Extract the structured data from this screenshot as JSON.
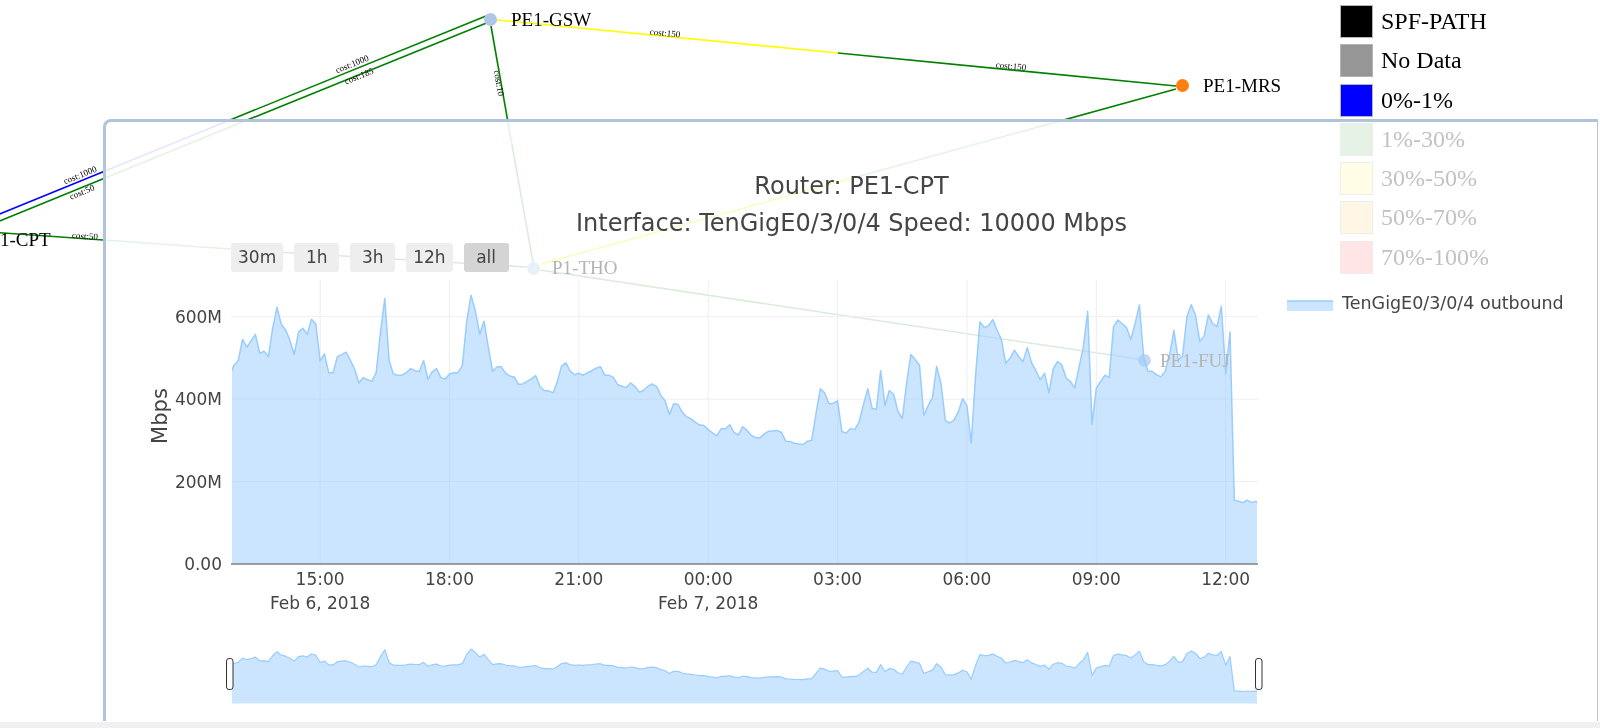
{
  "network_map": {
    "links": [
      {
        "color": "#008000",
        "cost": "cost:1000",
        "dimmed": false
      },
      {
        "color": "#0000ff",
        "cost": "cost:1000",
        "dimmed": false
      },
      {
        "color": "#008000",
        "cost": "cost:185",
        "dimmed": false
      },
      {
        "color": "#008000",
        "cost": "cost:50",
        "dimmed": false
      },
      {
        "color": "#008000",
        "cost": "cost:10",
        "dimmed": false
      },
      {
        "color": "#dcecdc",
        "dimmed": true
      },
      {
        "color": "#ffff00",
        "cost": "cost:150",
        "dimmed": false
      },
      {
        "color": "#008000",
        "cost": "cost:150",
        "dimmed": false
      },
      {
        "color": "#008000",
        "dimmed": false
      },
      {
        "color": "#fbfbc4",
        "dimmed": true
      },
      {
        "color": "#008000",
        "cost": "cost:50",
        "dimmed": false
      },
      {
        "color": "#dcecdc",
        "dimmed": true
      },
      {
        "color": "#dcecdc",
        "dimmed": true
      },
      {
        "color": "#dcecdc",
        "dimmed": true
      }
    ],
    "nodes": [
      {
        "label": "PE1-GSW",
        "color": "#aec7e8",
        "dimmed": false
      },
      {
        "label": "PE1-MRS",
        "color": "#ff7f0e",
        "dimmed": false
      },
      {
        "label": "1-CPT",
        "dimmed": false
      },
      {
        "label": "P1-THO",
        "color": "#eaf0f8",
        "dimmed": true
      },
      {
        "label": "PE1-FUJ",
        "color": "#c4d9ef",
        "dimmed": true
      }
    ],
    "legend": [
      {
        "label": "SPF-PATH",
        "color": "#000000",
        "dimmed": false
      },
      {
        "label": "No Data",
        "color": "#969696",
        "dimmed": false
      },
      {
        "label": "0%-1%",
        "color": "#0000ff",
        "dimmed": false
      },
      {
        "label": "1%-30%",
        "color": "#e5f2e5",
        "dimmed": true
      },
      {
        "label": "30%-50%",
        "color": "#fffde5",
        "dimmed": true
      },
      {
        "label": "50%-70%",
        "color": "#fff6e5",
        "dimmed": true
      },
      {
        "label": "70%-100%",
        "color": "#ffe5e5",
        "dimmed": true
      }
    ]
  },
  "chart_panel": {
    "subtitle": "Interface: TenGigE0/3/0/4 Speed: 10000 Mbps",
    "range_buttons": [
      {
        "label": "30m",
        "selected": false
      },
      {
        "label": "1h",
        "selected": false
      },
      {
        "label": "3h",
        "selected": false
      },
      {
        "label": "12h",
        "selected": false
      },
      {
        "label": "all",
        "selected": true
      }
    ],
    "chart_data": {
      "type": "area",
      "title": "Router: PE1-CPT",
      "ylabel": "Mbps",
      "grid": true,
      "x": [
        "2018-02-06 12:56",
        "2018-02-06 13:00",
        "2018-02-06 13:06",
        "2018-02-06 13:12",
        "2018-02-06 13:18",
        "2018-02-06 13:24",
        "2018-02-06 13:30",
        "2018-02-06 13:36",
        "2018-02-06 13:42",
        "2018-02-06 13:48",
        "2018-02-06 13:54",
        "2018-02-06 14:00",
        "2018-02-06 14:06",
        "2018-02-06 14:12",
        "2018-02-06 14:18",
        "2018-02-06 14:24",
        "2018-02-06 14:30",
        "2018-02-06 14:36",
        "2018-02-06 14:42",
        "2018-02-06 14:48",
        "2018-02-06 14:54",
        "2018-02-06 15:00",
        "2018-02-06 15:06",
        "2018-02-06 15:12",
        "2018-02-06 15:18",
        "2018-02-06 15:24",
        "2018-02-06 15:30",
        "2018-02-06 15:36",
        "2018-02-06 15:42",
        "2018-02-06 15:48",
        "2018-02-06 15:54",
        "2018-02-06 16:00",
        "2018-02-06 16:06",
        "2018-02-06 16:12",
        "2018-02-06 16:18",
        "2018-02-06 16:24",
        "2018-02-06 16:30",
        "2018-02-06 16:36",
        "2018-02-06 16:42",
        "2018-02-06 16:48",
        "2018-02-06 16:54",
        "2018-02-06 17:00",
        "2018-02-06 17:06",
        "2018-02-06 17:12",
        "2018-02-06 17:18",
        "2018-02-06 17:24",
        "2018-02-06 17:30",
        "2018-02-06 17:36",
        "2018-02-06 17:42",
        "2018-02-06 17:48",
        "2018-02-06 17:54",
        "2018-02-06 18:00",
        "2018-02-06 18:06",
        "2018-02-06 18:12",
        "2018-02-06 18:18",
        "2018-02-06 18:24",
        "2018-02-06 18:30",
        "2018-02-06 18:36",
        "2018-02-06 18:42",
        "2018-02-06 18:48",
        "2018-02-06 18:54",
        "2018-02-06 19:00",
        "2018-02-06 19:06",
        "2018-02-06 19:12",
        "2018-02-06 19:18",
        "2018-02-06 19:24",
        "2018-02-06 19:30",
        "2018-02-06 19:36",
        "2018-02-06 19:42",
        "2018-02-06 19:48",
        "2018-02-06 19:54",
        "2018-02-06 20:00",
        "2018-02-06 20:06",
        "2018-02-06 20:12",
        "2018-02-06 20:18",
        "2018-02-06 20:24",
        "2018-02-06 20:30",
        "2018-02-06 20:36",
        "2018-02-06 20:42",
        "2018-02-06 20:48",
        "2018-02-06 20:54",
        "2018-02-06 21:00",
        "2018-02-06 21:06",
        "2018-02-06 21:12",
        "2018-02-06 21:18",
        "2018-02-06 21:24",
        "2018-02-06 21:30",
        "2018-02-06 21:36",
        "2018-02-06 21:42",
        "2018-02-06 21:48",
        "2018-02-06 21:54",
        "2018-02-06 22:00",
        "2018-02-06 22:06",
        "2018-02-06 22:12",
        "2018-02-06 22:18",
        "2018-02-06 22:24",
        "2018-02-06 22:30",
        "2018-02-06 22:36",
        "2018-02-06 22:42",
        "2018-02-06 22:48",
        "2018-02-06 22:54",
        "2018-02-06 23:00",
        "2018-02-06 23:06",
        "2018-02-06 23:12",
        "2018-02-06 23:18",
        "2018-02-06 23:24",
        "2018-02-06 23:30",
        "2018-02-06 23:36",
        "2018-02-06 23:42",
        "2018-02-06 23:48",
        "2018-02-06 23:54",
        "2018-02-07 00:00",
        "2018-02-07 00:06",
        "2018-02-07 00:12",
        "2018-02-07 00:18",
        "2018-02-07 00:24",
        "2018-02-07 00:30",
        "2018-02-07 00:36",
        "2018-02-07 00:42",
        "2018-02-07 00:48",
        "2018-02-07 00:54",
        "2018-02-07 01:00",
        "2018-02-07 01:06",
        "2018-02-07 01:12",
        "2018-02-07 01:18",
        "2018-02-07 01:24",
        "2018-02-07 01:30",
        "2018-02-07 01:36",
        "2018-02-07 01:42",
        "2018-02-07 01:48",
        "2018-02-07 01:54",
        "2018-02-07 02:00",
        "2018-02-07 02:06",
        "2018-02-07 02:12",
        "2018-02-07 02:18",
        "2018-02-07 02:24",
        "2018-02-07 02:30",
        "2018-02-07 02:36",
        "2018-02-07 02:42",
        "2018-02-07 02:48",
        "2018-02-07 02:54",
        "2018-02-07 03:00",
        "2018-02-07 03:06",
        "2018-02-07 03:12",
        "2018-02-07 03:18",
        "2018-02-07 03:24",
        "2018-02-07 03:30",
        "2018-02-07 03:36",
        "2018-02-07 03:42",
        "2018-02-07 03:48",
        "2018-02-07 03:54",
        "2018-02-07 04:00",
        "2018-02-07 04:06",
        "2018-02-07 04:12",
        "2018-02-07 04:18",
        "2018-02-07 04:24",
        "2018-02-07 04:30",
        "2018-02-07 04:36",
        "2018-02-07 04:42",
        "2018-02-07 04:48",
        "2018-02-07 04:54",
        "2018-02-07 05:00",
        "2018-02-07 05:06",
        "2018-02-07 05:12",
        "2018-02-07 05:18",
        "2018-02-07 05:24",
        "2018-02-07 05:30",
        "2018-02-07 05:36",
        "2018-02-07 05:42",
        "2018-02-07 05:48",
        "2018-02-07 05:54",
        "2018-02-07 06:00",
        "2018-02-07 06:06",
        "2018-02-07 06:12",
        "2018-02-07 06:18",
        "2018-02-07 06:24",
        "2018-02-07 06:30",
        "2018-02-07 06:36",
        "2018-02-07 06:42",
        "2018-02-07 06:48",
        "2018-02-07 06:54",
        "2018-02-07 07:00",
        "2018-02-07 07:06",
        "2018-02-07 07:12",
        "2018-02-07 07:18",
        "2018-02-07 07:24",
        "2018-02-07 07:30",
        "2018-02-07 07:36",
        "2018-02-07 07:42",
        "2018-02-07 07:48",
        "2018-02-07 07:54",
        "2018-02-07 08:00",
        "2018-02-07 08:06",
        "2018-02-07 08:12",
        "2018-02-07 08:18",
        "2018-02-07 08:24",
        "2018-02-07 08:30",
        "2018-02-07 08:36",
        "2018-02-07 08:42",
        "2018-02-07 08:48",
        "2018-02-07 08:54",
        "2018-02-07 09:00",
        "2018-02-07 09:06",
        "2018-02-07 09:12",
        "2018-02-07 09:18",
        "2018-02-07 09:24",
        "2018-02-07 09:30",
        "2018-02-07 09:36",
        "2018-02-07 09:42",
        "2018-02-07 09:48",
        "2018-02-07 09:54",
        "2018-02-07 10:00",
        "2018-02-07 10:06",
        "2018-02-07 10:12",
        "2018-02-07 10:18",
        "2018-02-07 10:24",
        "2018-02-07 10:30",
        "2018-02-07 10:36",
        "2018-02-07 10:42",
        "2018-02-07 10:48",
        "2018-02-07 10:54",
        "2018-02-07 11:00",
        "2018-02-07 11:06",
        "2018-02-07 11:12",
        "2018-02-07 11:18",
        "2018-02-07 11:24",
        "2018-02-07 11:30",
        "2018-02-07 11:36",
        "2018-02-07 11:42",
        "2018-02-07 11:48",
        "2018-02-07 11:54",
        "2018-02-07 12:00",
        "2018-02-07 12:06",
        "2018-02-07 12:12",
        "2018-02-07 12:18",
        "2018-02-07 12:24",
        "2018-02-07 12:30",
        "2018-02-07 12:36",
        "2018-02-07 12:42",
        "2018-02-07 12:45"
      ],
      "series": [
        {
          "name": "TenGigE0/3/0/4 outbound",
          "color": "#99ccff",
          "values": [
            464,
            482,
            493,
            545,
            526,
            541,
            557,
            511,
            516,
            503,
            572,
            623,
            581,
            568,
            543,
            508,
            563,
            572,
            557,
            594,
            582,
            493,
            510,
            464,
            464,
            503,
            508,
            514,
            495,
            473,
            439,
            452,
            447,
            443,
            464,
            563,
            644,
            493,
            461,
            458,
            458,
            464,
            474,
            469,
            467,
            494,
            448,
            466,
            474,
            452,
            449,
            461,
            464,
            464,
            482,
            588,
            652,
            613,
            557,
            589,
            526,
            467,
            478,
            479,
            463,
            456,
            454,
            436,
            437,
            443,
            449,
            457,
            430,
            421,
            420,
            415,
            443,
            480,
            488,
            468,
            459,
            463,
            458,
            464,
            469,
            475,
            479,
            458,
            458,
            453,
            435,
            431,
            428,
            439,
            431,
            417,
            421,
            431,
            437,
            431,
            409,
            396,
            363,
            389,
            387,
            368,
            357,
            352,
            344,
            337,
            336,
            326,
            318,
            311,
            328,
            328,
            338,
            319,
            313,
            333,
            324,
            312,
            307,
            306,
            316,
            322,
            323,
            324,
            319,
            298,
            297,
            293,
            291,
            290,
            298,
            300,
            365,
            425,
            415,
            389,
            390,
            396,
            321,
            318,
            329,
            326,
            345,
            386,
            425,
            378,
            375,
            469,
            384,
            421,
            412,
            371,
            353,
            439,
            508,
            496,
            482,
            361,
            384,
            403,
            479,
            436,
            348,
            342,
            349,
            369,
            401,
            384,
            293,
            457,
            587,
            574,
            578,
            593,
            567,
            545,
            487,
            499,
            519,
            503,
            491,
            525,
            488,
            469,
            447,
            463,
            415,
            473,
            491,
            483,
            451,
            443,
            427,
            477,
            527,
            613,
            340,
            426,
            443,
            458,
            452,
            576,
            592,
            583,
            574,
            545,
            583,
            628,
            501,
            468,
            467,
            459,
            454,
            468,
            508,
            567,
            495,
            504,
            600,
            629,
            604,
            540,
            553,
            604,
            583,
            576,
            625,
            462,
            563,
            155,
            152,
            149,
            155,
            149,
            152,
            146
          ]
        }
      ],
      "xlim": [
        "2018-02-06 12:56",
        "2018-02-07 12:45"
      ],
      "ylim": [
        0,
        689
      ],
      "xticks": [
        {
          "value": "2018-02-06 15:00",
          "label": "15:00"
        },
        {
          "value": "2018-02-06 18:00",
          "label": "18:00"
        },
        {
          "value": "2018-02-06 21:00",
          "label": "21:00"
        },
        {
          "value": "2018-02-07 00:00",
          "label": "00:00"
        },
        {
          "value": "2018-02-07 03:00",
          "label": "03:00"
        },
        {
          "value": "2018-02-07 06:00",
          "label": "06:00"
        },
        {
          "value": "2018-02-07 09:00",
          "label": "09:00"
        },
        {
          "value": "2018-02-07 12:00",
          "label": "12:00"
        }
      ],
      "yticks": [
        {
          "value": 0,
          "label": "0.00"
        },
        {
          "value": 200,
          "label": "200M"
        },
        {
          "value": 400,
          "label": "400M"
        },
        {
          "value": 600,
          "label": "600M"
        }
      ],
      "annotations": [
        "Feb 6, 2018",
        "Feb 7, 2018"
      ]
    }
  }
}
